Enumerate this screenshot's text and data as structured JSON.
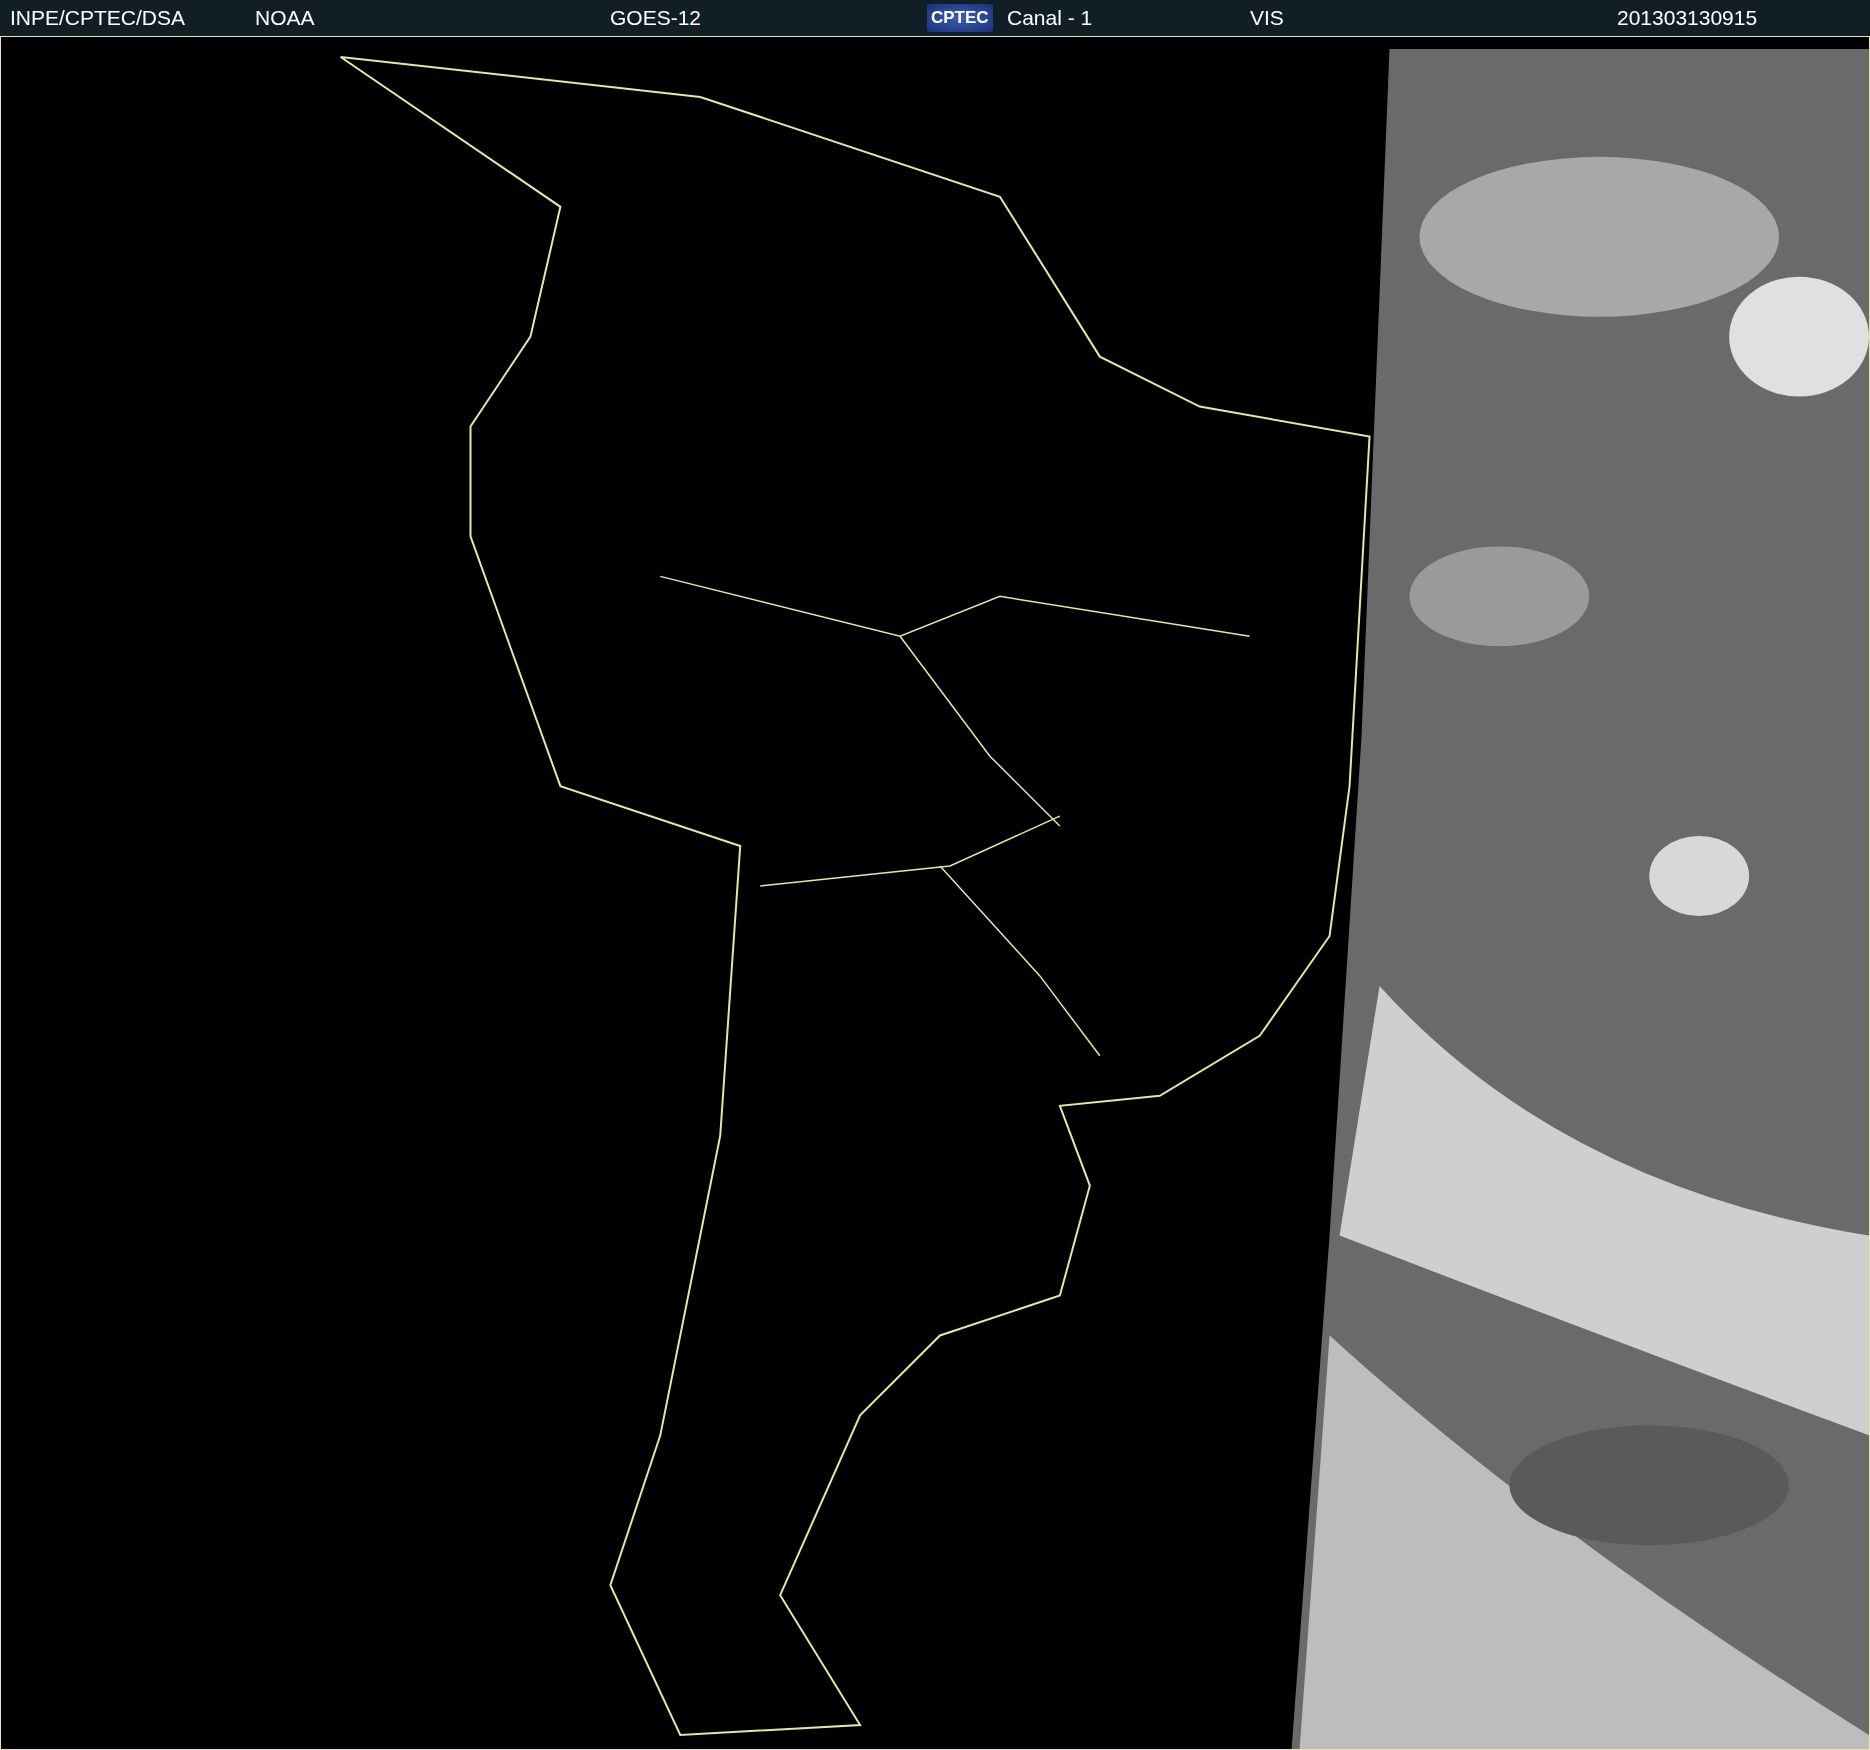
{
  "header": {
    "items": [
      {
        "kind": "text",
        "text": "INPE/CPTEC/DSA"
      },
      {
        "kind": "text",
        "text": "NOAA"
      },
      {
        "kind": "text",
        "text": "GOES-12"
      },
      {
        "kind": "logo",
        "text": "CPTEC"
      },
      {
        "kind": "text",
        "text": "Canal - 1"
      },
      {
        "kind": "text",
        "text": "VIS"
      },
      {
        "kind": "text",
        "text": "201303130915"
      }
    ]
  }
}
